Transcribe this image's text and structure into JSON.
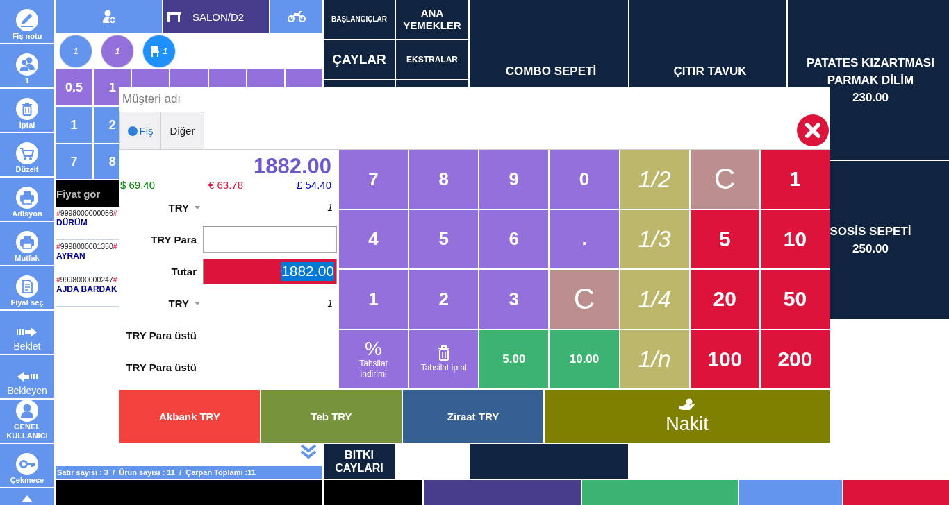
{
  "sidebar": {
    "items": [
      {
        "kind": "note",
        "label": "Fiş notu"
      },
      {
        "kind": "users",
        "label": "1"
      },
      {
        "kind": "trash",
        "label": "İptal"
      },
      {
        "kind": "cart",
        "label": "Düzelt"
      },
      {
        "kind": "printer",
        "label": "Adisyon"
      },
      {
        "kind": "printer",
        "label": "Mutfak"
      },
      {
        "kind": "tags",
        "label": "Fiyat seç"
      },
      {
        "kind": "hold",
        "label": "Beklet"
      },
      {
        "kind": "recall",
        "label": "Bekleyen"
      },
      {
        "kind": "user",
        "label": "GENEL KULLANICI"
      },
      {
        "kind": "key",
        "label": "Çekmece"
      },
      {
        "kind": "up"
      }
    ]
  },
  "order_panel": {
    "header_buttons": [
      {
        "kind": "customer",
        "selected": false
      },
      {
        "kind": "table",
        "label": "SALON/D2",
        "selected": true
      },
      {
        "kind": "delivery",
        "selected": false
      }
    ],
    "badges": [
      {
        "kind": "count",
        "label": "1",
        "color": "#6495ed"
      },
      {
        "kind": "count",
        "label": "1",
        "color": "#9370db"
      },
      {
        "kind": "seat",
        "label": "1",
        "color": "#1e90ff"
      }
    ],
    "quantity_pad": [
      {
        "kind": "multiplier",
        "keys": [
          "0.5",
          "1"
        ]
      },
      {
        "kind": "digit",
        "keys": [
          "1",
          "2"
        ]
      },
      {
        "kind": "digit",
        "keys": [
          "7",
          "8"
        ]
      }
    ],
    "price_lookup": {
      "placeholder": "Fiyat gör"
    },
    "items": [
      {
        "mark_open": "#",
        "code": "9998000000056",
        "mark_close": "#",
        "name": "DÜRÜM"
      },
      {
        "mark_open": "#",
        "code": "9998000001350",
        "mark_close": "#",
        "name": "AYRAN"
      },
      {
        "mark_open": "#",
        "code": "9998000000247",
        "mark_close": "#",
        "name": "AJDA BARDAK"
      }
    ],
    "status_bar": "Satır sayısı : 3  /  Ürün sayısı : 11  /  Çarpan Toplamı :11"
  },
  "categories": {
    "rows": [
      {
        "items": [
          {
            "label": "BAŞLANGIÇLAR"
          },
          {
            "label": "ANA YEMEKLER"
          }
        ]
      },
      {
        "items": [
          {
            "label": "ÇAYLAR"
          },
          {
            "label": "EKSTRALAR"
          }
        ]
      }
    ],
    "bottom": [
      {
        "label": "BITKI CAYLARI"
      }
    ]
  },
  "products": [
    {
      "name": "COMBO SEPETİ"
    },
    {
      "name": "ÇITIR TAVUK"
    },
    {
      "name": "PATATES KIZARTMASI PARMAK DİLİM",
      "price": "230.00"
    },
    {
      "name": "SOSİS SEPETİ",
      "price": "250.00"
    }
  ],
  "bottom_bar": [
    {
      "color": "#000000"
    },
    {
      "color": "#000000"
    },
    {
      "color": "#483d8b"
    },
    {
      "color": "#3cb371"
    },
    {
      "color": "#6495ed"
    },
    {
      "color": "#dc143c"
    }
  ],
  "payment_dialog": {
    "customer_field": {
      "placeholder": "Müşteri adı"
    },
    "tabs": [
      {
        "label": "Fiş",
        "selected": true
      },
      {
        "label": "Diğer",
        "selected": false
      }
    ],
    "total": "1882.00",
    "foreign_totals": [
      {
        "text": "$ 69.40",
        "color": "#008000"
      },
      {
        "text": "€ 63.78",
        "color": "#dc143c"
      },
      {
        "text": "£ 54.40",
        "color": "#0000cd"
      }
    ],
    "rows": [
      {
        "kind": "currency",
        "label": "TRY",
        "rate": "1"
      },
      {
        "kind": "input",
        "label": "TRY Para"
      },
      {
        "kind": "amount",
        "label": "Tutar",
        "value": "1882.00",
        "value_selected": true
      },
      {
        "kind": "currency",
        "label": "TRY",
        "rate": "1"
      },
      {
        "kind": "change",
        "label": "TRY Para üstü"
      },
      {
        "kind": "change",
        "label": "TRY Para üstü"
      }
    ],
    "keypad": [
      {
        "kind": "digit",
        "label": "7"
      },
      {
        "kind": "digit",
        "label": "8"
      },
      {
        "kind": "digit",
        "label": "9"
      },
      {
        "kind": "digit",
        "label": "0"
      },
      {
        "kind": "fraction",
        "label": "1/2"
      },
      {
        "kind": "clear",
        "label": "C"
      },
      {
        "kind": "note",
        "label": "1"
      },
      {
        "kind": "digit",
        "label": "4"
      },
      {
        "kind": "digit",
        "label": "5"
      },
      {
        "kind": "digit",
        "label": "6"
      },
      {
        "kind": "digit",
        "label": "."
      },
      {
        "kind": "fraction",
        "label": "1/3"
      },
      {
        "kind": "note",
        "label": "5"
      },
      {
        "kind": "note",
        "label": "10"
      },
      {
        "kind": "digit",
        "label": "1"
      },
      {
        "kind": "digit",
        "label": "2"
      },
      {
        "kind": "digit",
        "label": "3"
      },
      {
        "kind": "clear",
        "label": "C"
      },
      {
        "kind": "fraction",
        "label": "1/4"
      },
      {
        "kind": "note",
        "label": "20"
      },
      {
        "kind": "note",
        "label": "50"
      },
      {
        "kind": "symbol_action",
        "symbol": "%",
        "label": "Tahsilat indirimi"
      },
      {
        "kind": "icon_action",
        "label": "Tahsilat iptal"
      },
      {
        "kind": "quick",
        "label": "5.00"
      },
      {
        "kind": "quick",
        "label": "10.00"
      },
      {
        "kind": "fraction",
        "label": "1/n"
      },
      {
        "kind": "note",
        "label": "100"
      },
      {
        "kind": "note",
        "label": "200"
      }
    ],
    "payment_buttons": [
      {
        "kind": "bank",
        "label": "Akbank TRY",
        "color": "#f4433c"
      },
      {
        "kind": "bank",
        "label": "Teb TRY",
        "color": "#77933c"
      },
      {
        "kind": "bank",
        "label": "Ziraat TRY",
        "color": "#366092"
      },
      {
        "kind": "cash",
        "label": "Nakit",
        "color": "#808000"
      }
    ]
  }
}
